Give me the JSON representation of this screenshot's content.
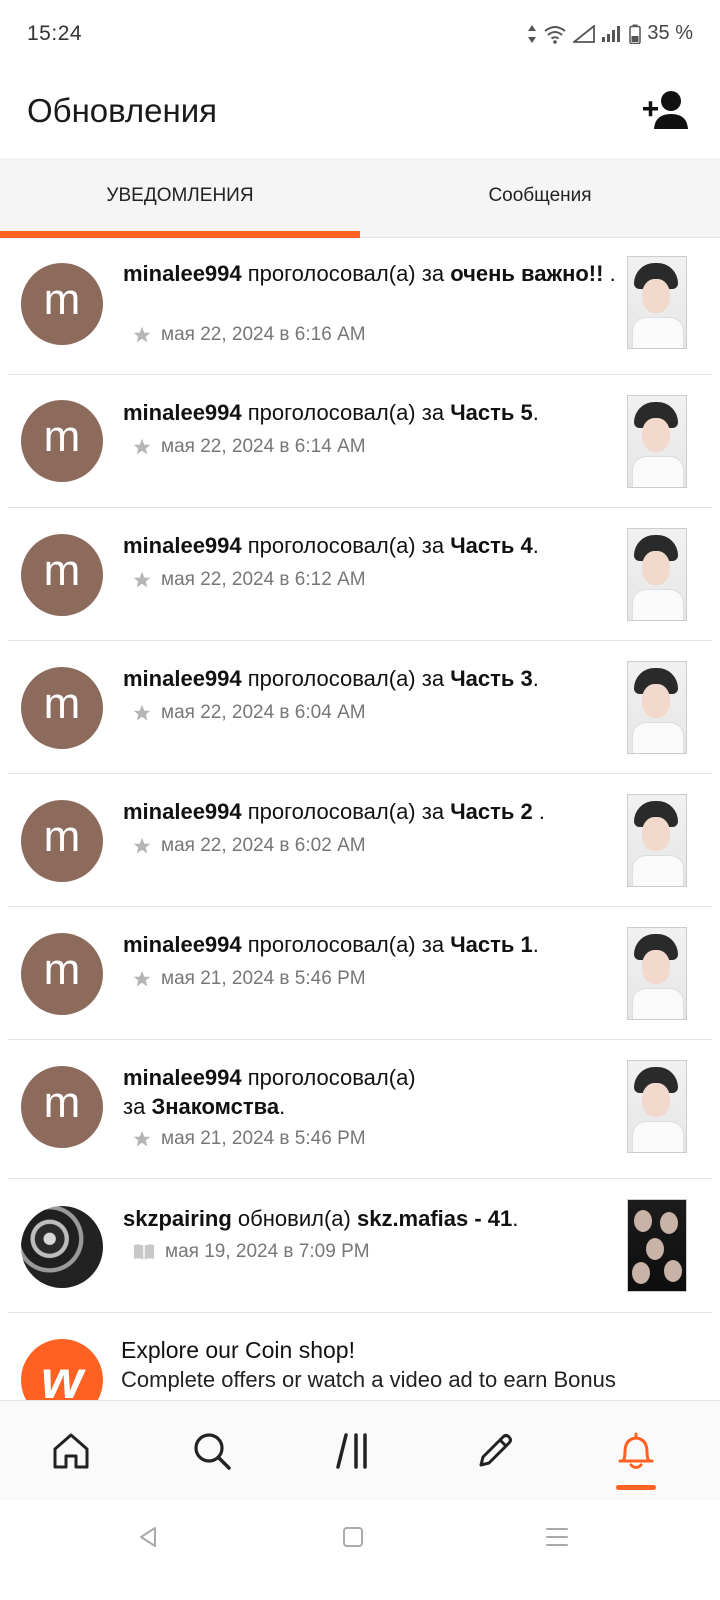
{
  "status_bar": {
    "time": "15:24",
    "battery": "35 %"
  },
  "header": {
    "title": "Обновления"
  },
  "tabs": [
    {
      "label": "УВЕДОМЛЕНИЯ",
      "active": true
    },
    {
      "label": "Сообщения",
      "active": false
    }
  ],
  "colors": {
    "accent": "#ff6122",
    "avatar_m": "#8c6b5d"
  },
  "notifications": [
    {
      "avatar_letter": "m",
      "user": "minalee994",
      "action": " проголосовал(а) за ",
      "target": "очень важно!!",
      "suffix": " .",
      "time": "мая 22, 2024 в 6:16 AM",
      "icon": "star-icon"
    },
    {
      "avatar_letter": "m",
      "user": "minalee994",
      "action": " проголосовал(а) за ",
      "target": "Часть 5",
      "suffix": ".",
      "time": "мая 22, 2024 в 6:14 AM",
      "icon": "star-icon"
    },
    {
      "avatar_letter": "m",
      "user": "minalee994",
      "action": " проголосовал(а) за ",
      "target": "Часть 4",
      "suffix": ".",
      "time": "мая 22, 2024 в 6:12 AM",
      "icon": "star-icon"
    },
    {
      "avatar_letter": "m",
      "user": "minalee994",
      "action": " проголосовал(а) за ",
      "target": "Часть 3",
      "suffix": ".",
      "time": "мая 22, 2024 в 6:04 AM",
      "icon": "star-icon"
    },
    {
      "avatar_letter": "m",
      "user": "minalee994",
      "action": " проголосовал(а) за ",
      "target": "Часть 2 ",
      "suffix": ".",
      "time": "мая 22, 2024 в 6:02 AM",
      "icon": "star-icon"
    },
    {
      "avatar_letter": "m",
      "user": "minalee994",
      "action": " проголосовал(а) за ",
      "target": "Часть 1",
      "suffix": ".",
      "time": "мая 21, 2024 в 5:46 PM",
      "icon": "star-icon"
    },
    {
      "avatar_letter": "m",
      "user": "minalee994",
      "action": " проголосовал(а) за ",
      "target": "Знакомства",
      "suffix": ".",
      "time": "мая 21, 2024 в 5:46 PM",
      "icon": "star-icon"
    },
    {
      "avatar_letter": "",
      "user": "skzpairing",
      "action": " обновил(а) ",
      "target": "skz.mafias - 41",
      "suffix": ".",
      "time": "мая 19, 2024 в 7:09 PM",
      "icon": "book-icon"
    }
  ],
  "promo": {
    "title": "Explore our Coin shop!",
    "subtitle": "Complete offers or watch a video ad to earn Bonus"
  },
  "bottom_nav": [
    "home-icon",
    "search-icon",
    "library-icon",
    "write-icon",
    "bell-icon"
  ]
}
